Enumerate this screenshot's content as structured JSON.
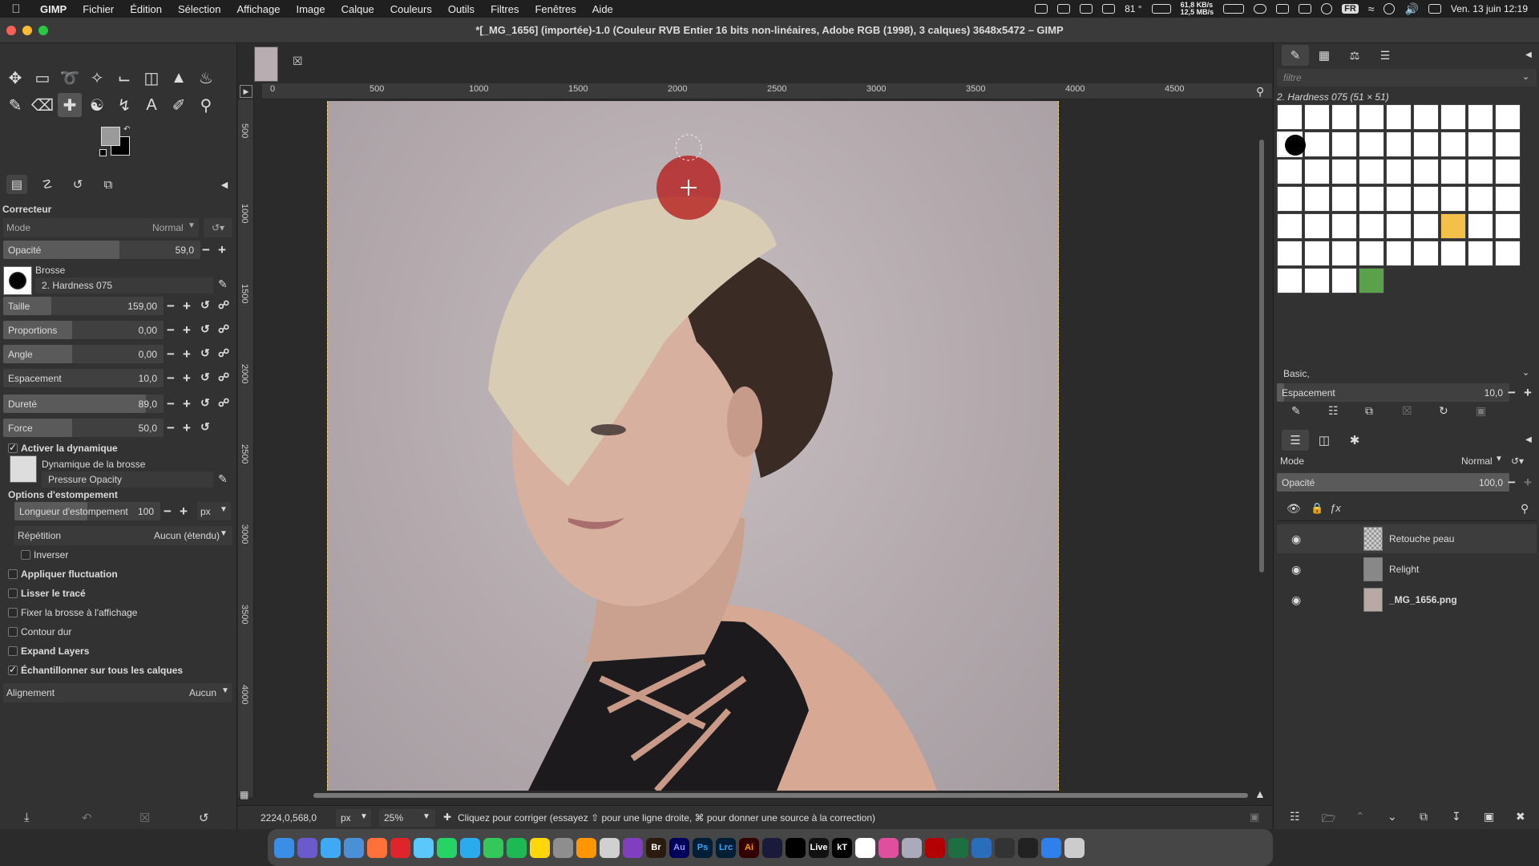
{
  "menubar": {
    "items": [
      "GIMP",
      "Fichier",
      "Édition",
      "Sélection",
      "Affichage",
      "Image",
      "Calque",
      "Couleurs",
      "Outils",
      "Filtres",
      "Fenêtres",
      "Aide"
    ],
    "temp": "81 °",
    "net_up": "61,8 KB/s",
    "net_down": "12,5 MB/s",
    "lang": "FR",
    "datetime": "Ven. 13 juin  12:19"
  },
  "window": {
    "title": "*[_MG_1656] (importée)-1.0 (Couleur RVB Entier 16 bits non-linéaires, Adobe RGB (1998), 3 calques) 3648x5472 – GIMP"
  },
  "tool_options": {
    "tool_name": "Correcteur",
    "mode_label": "Mode",
    "mode_value": "Normal",
    "opacity_label": "Opacité",
    "opacity_value": "59,0",
    "brush_label": "Brosse",
    "brush_value": "2. Hardness 075",
    "size_label": "Taille",
    "size_value": "159,00",
    "proportions_label": "Proportions",
    "proportions_value": "0,00",
    "angle_label": "Angle",
    "angle_value": "0,00",
    "spacing_label": "Espacement",
    "spacing_value": "10,0",
    "hardness_label": "Dureté",
    "hardness_value": "89,0",
    "force_label": "Force",
    "force_value": "50,0",
    "dynamics_enable": "Activer la dynamique",
    "dynamics_label": "Dynamique de la brosse",
    "dynamics_value": "Pressure Opacity",
    "fade_header": "Options d'estompement",
    "fade_length_label": "Longueur d'estompement",
    "fade_length_value": "100",
    "fade_unit": "px",
    "repeat_label": "Répétition",
    "repeat_value": "Aucun (étendu)",
    "reverse_label": "Inverser",
    "jitter_label": "Appliquer fluctuation",
    "smooth_label": "Lisser le tracé",
    "lock_view_label": "Fixer la brosse à l'affichage",
    "hard_edge_label": "Contour dur",
    "expand_layers_label": "Expand Layers",
    "sample_all_label": "Échantillonner sur tous les calques",
    "alignment_label": "Alignement",
    "alignment_value": "Aucun"
  },
  "ruler": {
    "h_ticks": [
      "0",
      "500",
      "1000",
      "1500",
      "2000",
      "2500",
      "3000",
      "3500",
      "4000",
      "4500"
    ],
    "v_ticks": [
      "500",
      "1000",
      "1500",
      "2000",
      "2500",
      "3000",
      "3500",
      "4000"
    ]
  },
  "brushes_panel": {
    "filter_placeholder": "filtre",
    "selected_brush": "2. Hardness 075 (51 × 51)",
    "preset": "Basic,",
    "spacing_label": "Espacement",
    "spacing_value": "10,0"
  },
  "layers_panel": {
    "mode_label": "Mode",
    "mode_value": "Normal",
    "opacity_label": "Opacité",
    "opacity_value": "100,0",
    "layers": [
      "Retouche peau",
      "Relight",
      "_MG_1656.png"
    ]
  },
  "statusbar": {
    "coords": "2224,0,568,0",
    "unit": "px",
    "zoom": "25%",
    "message": "Cliquez pour corriger (essayez ⇧ pour une ligne droite, ⌘ pour donner une source à la correction)"
  },
  "dock": {
    "apps": [
      "Finder",
      "Launchpad",
      "Safari",
      "Mail",
      "Firefox",
      "Opera",
      "Mail",
      "WhatsApp",
      "Telegram",
      "Messages",
      "Spotify",
      "Notes",
      "GIMP",
      "Paw",
      "Affinity",
      "Br",
      "Au",
      "Ps",
      "Lrc",
      "Ai",
      "Fc",
      "Terminal",
      "Live",
      "kT",
      "Unity",
      "App",
      "FileZilla",
      "Excel",
      "Dock",
      "Sketch",
      "Terminal",
      "Cloud",
      "Slack",
      "Live",
      "Trash"
    ]
  }
}
